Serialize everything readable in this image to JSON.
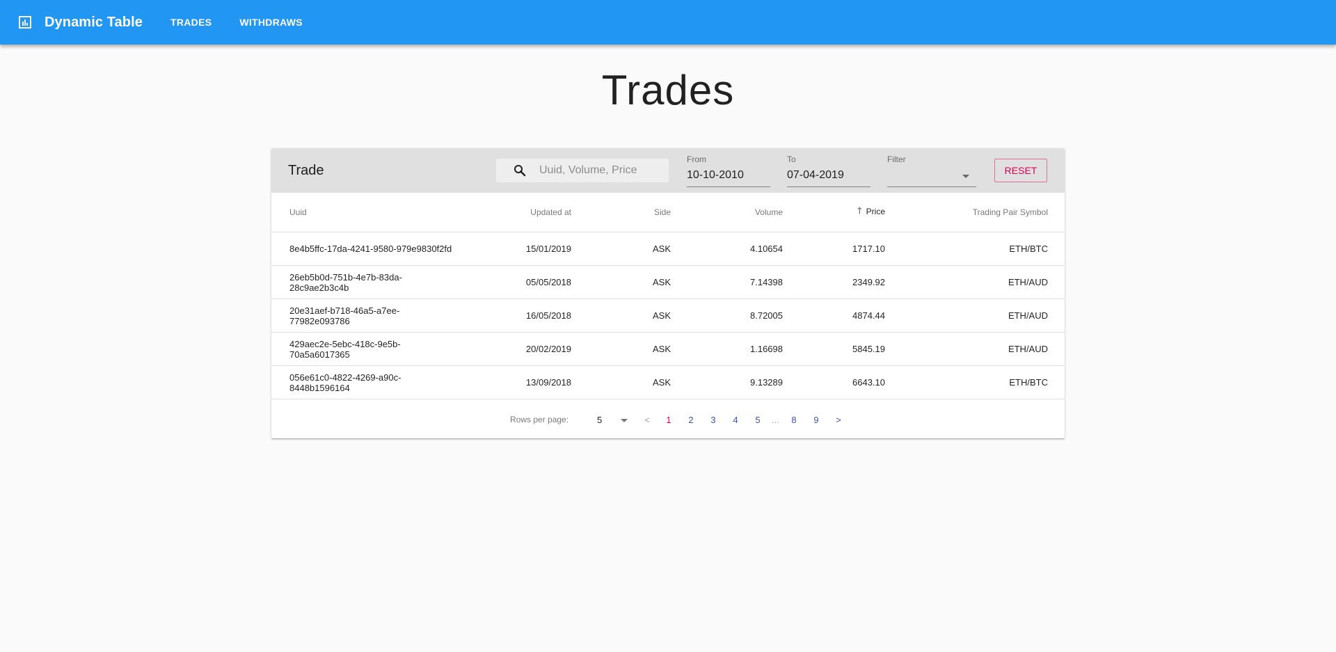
{
  "appbar": {
    "icon": "bar-chart-icon",
    "title": "Dynamic Table",
    "nav": [
      {
        "label": "TRADES"
      },
      {
        "label": "WITHDRAWS"
      }
    ]
  },
  "page": {
    "title": "Trades"
  },
  "toolbar": {
    "title": "Trade",
    "search_placeholder": "Uuid, Volume, Price",
    "from_label": "From",
    "from_value": "10-10-2010",
    "to_label": "To",
    "to_value": "07-04-2019",
    "filter_label": "Filter",
    "filter_value": "",
    "reset_label": "RESET"
  },
  "table": {
    "columns": [
      "Uuid",
      "Updated at",
      "Side",
      "Volume",
      "Price",
      "Trading Pair Symbol"
    ],
    "sorted_column": "Price",
    "sort_direction": "asc",
    "rows": [
      [
        "8e4b5ffc-17da-4241-9580-979e9830f2fd",
        "15/01/2019",
        "ASK",
        "4.10654",
        "1717.10",
        "ETH/BTC"
      ],
      [
        "26eb5b0d-751b-4e7b-83da-28c9ae2b3c4b",
        "05/05/2018",
        "ASK",
        "7.14398",
        "2349.92",
        "ETH/AUD"
      ],
      [
        "20e31aef-b718-46a5-a7ee-77982e093786",
        "16/05/2018",
        "ASK",
        "8.72005",
        "4874.44",
        "ETH/AUD"
      ],
      [
        "429aec2e-5ebc-418c-9e5b-70a5a6017365",
        "20/02/2019",
        "ASK",
        "1.16698",
        "5845.19",
        "ETH/AUD"
      ],
      [
        "056e61c0-4822-4269-a90c-8448b1596164",
        "13/09/2018",
        "ASK",
        "9.13289",
        "6643.10",
        "ETH/BTC"
      ]
    ]
  },
  "pagination": {
    "rows_per_page_label": "Rows per page:",
    "rows_per_page": "5",
    "prev": "<",
    "next": ">",
    "pages": [
      "1",
      "2",
      "3",
      "4",
      "5",
      "...",
      "8",
      "9"
    ],
    "current_page": "1"
  },
  "colors": {
    "appbar": "#2196f3",
    "accent": "#e10050",
    "link": "#3f51b5",
    "toolbar_bg": "#e0e0e0"
  }
}
